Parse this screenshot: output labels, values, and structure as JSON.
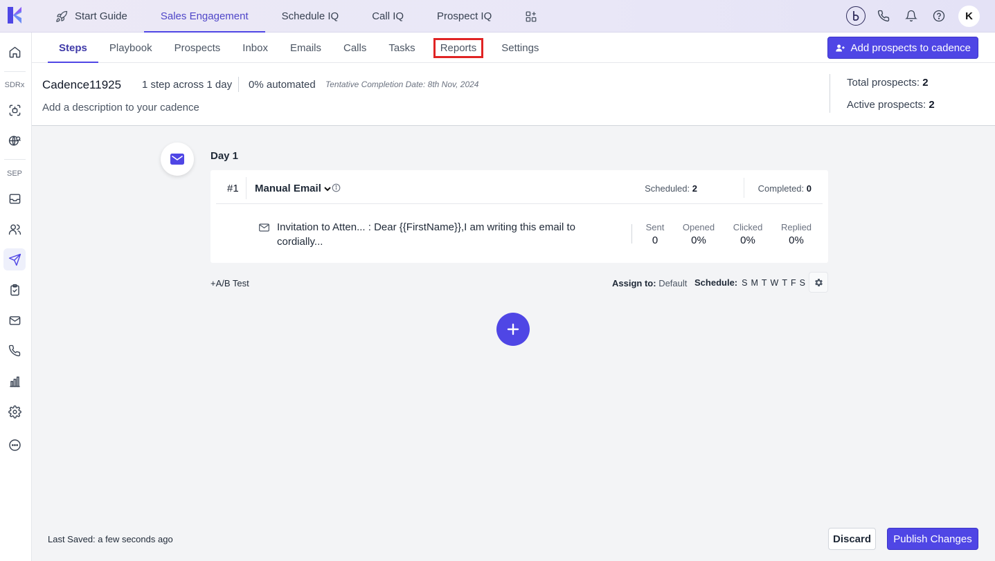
{
  "topnav": {
    "items": [
      {
        "label": "Start Guide",
        "icon": "rocket-icon"
      },
      {
        "label": "Sales Engagement",
        "active": true
      },
      {
        "label": "Schedule IQ"
      },
      {
        "label": "Call IQ"
      },
      {
        "label": "Prospect IQ"
      }
    ],
    "avatar_initial": "K"
  },
  "sidebar": {
    "section_sdrx": "SDRx",
    "section_sep": "SEP"
  },
  "subnav": {
    "tabs": [
      "Steps",
      "Playbook",
      "Prospects",
      "Inbox",
      "Emails",
      "Calls",
      "Tasks",
      "Reports",
      "Settings"
    ],
    "active_tab": "Steps",
    "highlighted_tab": "Reports",
    "add_button": "Add prospects to cadence"
  },
  "cadence": {
    "name": "Cadence11925",
    "steps_summary": "1 step across 1 day",
    "automated": "0% automated",
    "completion_date": "Tentative Completion Date: 8th Nov, 2024",
    "description_placeholder": "Add a description to your cadence",
    "total_prospects_label": "Total prospects:",
    "total_prospects": "2",
    "active_prospects_label": "Active prospects:",
    "active_prospects": "2"
  },
  "day": {
    "label": "Day 1",
    "step": {
      "number": "#1",
      "type": "Manual Email",
      "scheduled_label": "Scheduled:",
      "scheduled": "2",
      "completed_label": "Completed:",
      "completed": "0",
      "email_preview": "Invitation to Atten... : Dear {{FirstName}},I am writing this email to cordially...",
      "stats": [
        {
          "label": "Sent",
          "value": "0"
        },
        {
          "label": "Opened",
          "value": "0%"
        },
        {
          "label": "Clicked",
          "value": "0%"
        },
        {
          "label": "Replied",
          "value": "0%"
        }
      ]
    },
    "ab_test": "+A/B Test",
    "assign_label": "Assign to:",
    "assign_value": "Default",
    "schedule_label": "Schedule:",
    "schedule_days": [
      "S",
      "M",
      "T",
      "W",
      "T",
      "F",
      "S"
    ]
  },
  "footer": {
    "last_saved": "Last Saved: a few seconds ago",
    "discard": "Discard",
    "publish": "Publish Changes"
  },
  "colors": {
    "primary": "#4f46e5",
    "highlight_box": "#e02424"
  }
}
